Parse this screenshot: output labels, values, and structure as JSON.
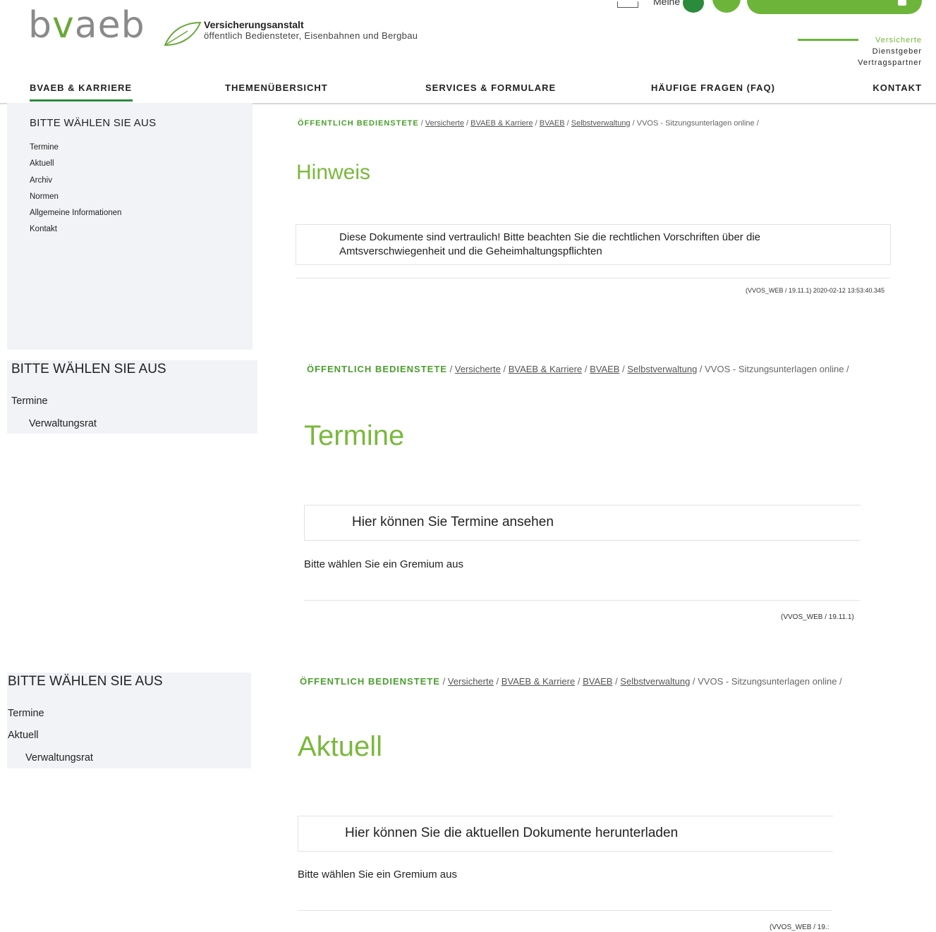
{
  "header": {
    "logo_prefix": "b",
    "logo_v": "v",
    "logo_rest": "aeb",
    "org_title": "Versicherungsanstalt",
    "org_subtitle": "öffentlich Bediensteter, Eisenbahnen und Bergbau",
    "meine_label": "Meine",
    "audiences": [
      "Versicherte",
      "Dienstgeber",
      "Vertragspartner"
    ],
    "accent": "#6cb53a"
  },
  "nav": {
    "items": [
      "BVAEB & KARRIERE",
      "THEMENÜBERSICHT",
      "SERVICES & FORMULARE",
      "HÄUFIGE FRAGEN (FAQ)",
      "KONTAKT"
    ]
  },
  "section1": {
    "sidebar_title": "BITTE WÄHLEN SIE AUS",
    "sidebar_items": [
      "Termine",
      "Aktuell",
      "Archiv",
      "Normen",
      "Allgemeine Informationen",
      "Kontakt"
    ],
    "breadcrumb": {
      "first": "ÖFFENTLICH BEDIENSTETE",
      "links": [
        "Versicherte",
        "BVAEB & Karriere",
        "BVAEB",
        "Selbstverwaltung"
      ],
      "last": "VVOS - Sitzungsunterlagen online /"
    },
    "heading": "Hinweis",
    "notice": "Diese Dokumente sind vertraulich! Bitte beachten Sie die rechtlichen Vorschriften über die Amtsverschwiegenheit und die Geheimhaltungspflichten",
    "footer": "(VVOS_WEB / 19.11.1) 2020-02-12 13:53:40.345"
  },
  "section2": {
    "sidebar_title": "BITTE WÄHLEN SIE AUS",
    "sidebar_items": [
      "Termine"
    ],
    "sub_item": "Verwaltungsrat",
    "breadcrumb": {
      "first": "ÖFFENTLICH BEDIENSTETE",
      "links": [
        "Versicherte",
        "BVAEB & Karriere",
        "BVAEB",
        "Selbstverwaltung"
      ],
      "last": "VVOS - Sitzungsunterlagen online /"
    },
    "heading": "Termine",
    "box_text": "Hier können Sie Termine ansehen",
    "prompt": "Bitte wählen Sie ein Gremium aus",
    "footer": "(VVOS_WEB / 19.11.1)"
  },
  "section3": {
    "sidebar_title": "BITTE WÄHLEN SIE AUS",
    "sidebar_items": [
      "Termine",
      "Aktuell"
    ],
    "sub_item": "Verwaltungsrat",
    "breadcrumb": {
      "first": "ÖFFENTLICH BEDIENSTETE",
      "links": [
        "Versicherte",
        "BVAEB & Karriere",
        "BVAEB",
        "Selbstverwaltung"
      ],
      "last": "VVOS - Sitzungsunterlagen online /"
    },
    "heading": "Aktuell",
    "box_text": "Hier können Sie die aktuellen Dokumente herunterladen",
    "prompt": "Bitte wählen Sie ein Gremium aus",
    "footer": "(VVOS_WEB / 19.:"
  }
}
